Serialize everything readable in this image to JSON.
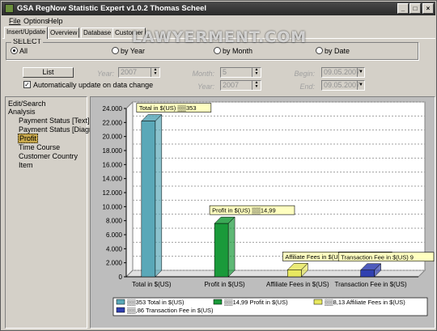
{
  "window": {
    "title": "GSA RegNow Statistic Expert v1.0.2  Thomas Scheel",
    "controls": [
      "_",
      "□",
      "×"
    ]
  },
  "menu": [
    "File",
    "Options",
    "Help"
  ],
  "tabs": [
    "Insert/Update",
    "Overview",
    "Database",
    "Customer"
  ],
  "watermark": "LAWYERMENT.COM",
  "select": {
    "legend": "SELECT",
    "options": [
      "All",
      "by Year",
      "by Month",
      "by Date"
    ],
    "selected": "All"
  },
  "controls": {
    "list_button": "List",
    "auto_update_label": "Automatically update on data change",
    "auto_update_checked": true,
    "year_label": "Year:",
    "year_value": "2007",
    "month_label": "Month:",
    "month_value": "5",
    "month_year_label": "Year:",
    "month_year_value": "2007",
    "begin_label": "Begin:",
    "begin_value": "09.05.2007",
    "end_label": "End:",
    "end_value": "09.05.2007"
  },
  "tree": {
    "items": [
      "Edit/Search",
      "Analysis",
      "Payment Status [Text]",
      "Payment Status [Diagram]",
      "Profit",
      "Time Course",
      "Customer Country",
      "Item"
    ],
    "selected": "Profit"
  },
  "chart_data": {
    "type": "bar",
    "categories": [
      "Total in $(US)",
      "Profit in $(US)",
      "Affiliate Fees in $(US)",
      "Transaction Fee in $(US)"
    ],
    "values": [
      22200,
      7600,
      1000,
      950
    ],
    "colors": [
      "#5aa8b8",
      "#1a9a3a",
      "#e8e860",
      "#3040b0"
    ],
    "data_labels": [
      "Total in $(US) ▒▒353",
      "Profit in $(US) ▒▒14,99",
      "Affiliate Fees in $(US) ▒58,13",
      "Transaction Fee in $(US) 9"
    ],
    "ylim": [
      0,
      24000
    ],
    "yticks": [
      "0",
      "2.000",
      "4.000",
      "6.000",
      "8.000",
      "10.000",
      "12.000",
      "14.000",
      "16.000",
      "18.000",
      "20.000",
      "22.000",
      "24.000"
    ],
    "legend": [
      "▒▒353 Total in $(US)",
      "▒▒14,99 Profit in $(US)",
      "▒▒8,13 Affiliate Fees in $(US)",
      "▒▒,86 Transaction Fee in $(US)"
    ],
    "grid": true
  }
}
